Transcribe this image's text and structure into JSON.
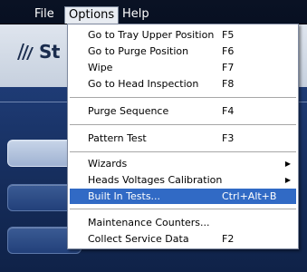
{
  "menubar": {
    "items": [
      {
        "label": "File"
      },
      {
        "label": "Options"
      },
      {
        "label": "Help"
      }
    ]
  },
  "logo": {
    "text": "St"
  },
  "options_menu": {
    "items": [
      {
        "label": "Go to Tray Upper Position",
        "shortcut": "F5"
      },
      {
        "label": "Go to Purge Position",
        "shortcut": "F6"
      },
      {
        "label": "Wipe",
        "shortcut": "F7"
      },
      {
        "label": "Go to Head Inspection",
        "shortcut": "F8"
      },
      {
        "label": "Purge Sequence",
        "shortcut": "F4"
      },
      {
        "label": "Pattern Test",
        "shortcut": "F3"
      },
      {
        "label": "Wizards",
        "shortcut": "",
        "submenu_icon": "triangle-right-icon"
      },
      {
        "label": "Heads Voltages Calibration",
        "shortcut": "",
        "submenu_icon": "triangle-right-icon"
      },
      {
        "label": "Built In Tests...",
        "shortcut": "Ctrl+Alt+B",
        "selected": true
      },
      {
        "label": "Maintenance Counters...",
        "shortcut": ""
      },
      {
        "label": "Collect Service Data",
        "shortcut": "F2"
      }
    ]
  },
  "colors": {
    "menubar_bg": "#0a1224",
    "selection": "#316ac5",
    "panel_dark": "#1e3b75"
  }
}
